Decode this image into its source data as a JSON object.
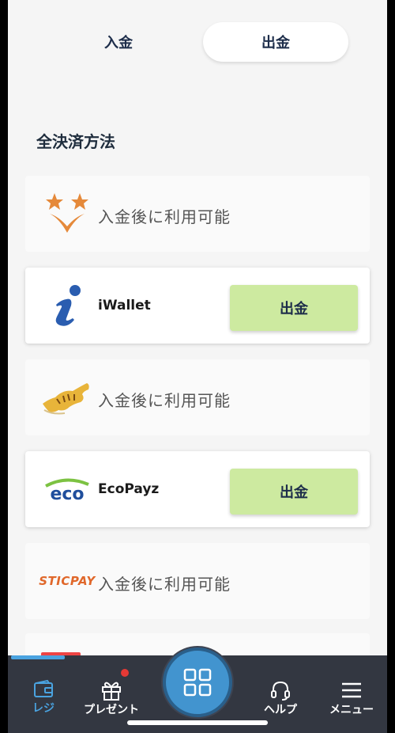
{
  "tabs": {
    "deposit_label": "入金",
    "withdraw_label": "出金",
    "active": "withdraw"
  },
  "section_title": "全決済方法",
  "methods": [
    {
      "name": "",
      "status": "入金後に利用可能",
      "logo_icon": "star-v-icon",
      "state": "disabled"
    },
    {
      "name": "iWallet",
      "status": "",
      "button_label": "出金",
      "logo_icon": "iwallet-icon",
      "state": "active"
    },
    {
      "name": "",
      "status": "入金後に利用可能",
      "logo_icon": "tiger-icon",
      "state": "disabled"
    },
    {
      "name": "EcoPayz",
      "status": "",
      "button_label": "出金",
      "logo_icon": "eco-icon",
      "logo_text": "eco",
      "state": "active"
    },
    {
      "name": "",
      "status": "入金後に利用可能",
      "logo_icon": "sticpay-icon",
      "logo_text": "STICPAY",
      "state": "disabled"
    }
  ],
  "bottom_nav": {
    "items": [
      {
        "label": "レジ",
        "icon": "wallet-icon",
        "active": true
      },
      {
        "label": "プレゼント",
        "icon": "gift-icon",
        "badge": true
      },
      {
        "label": "",
        "icon": "grid-icon"
      },
      {
        "label": "ヘルプ",
        "icon": "headset-icon"
      },
      {
        "label": "メニュー",
        "icon": "hamburger-icon"
      }
    ]
  },
  "colors": {
    "accent": "#4aa3e0",
    "button_green": "#cdeaa0",
    "nav_bg": "#333741",
    "text_dark": "#1d2d4a",
    "sticpay_orange": "#e0672a",
    "badge_red": "#e53935"
  }
}
